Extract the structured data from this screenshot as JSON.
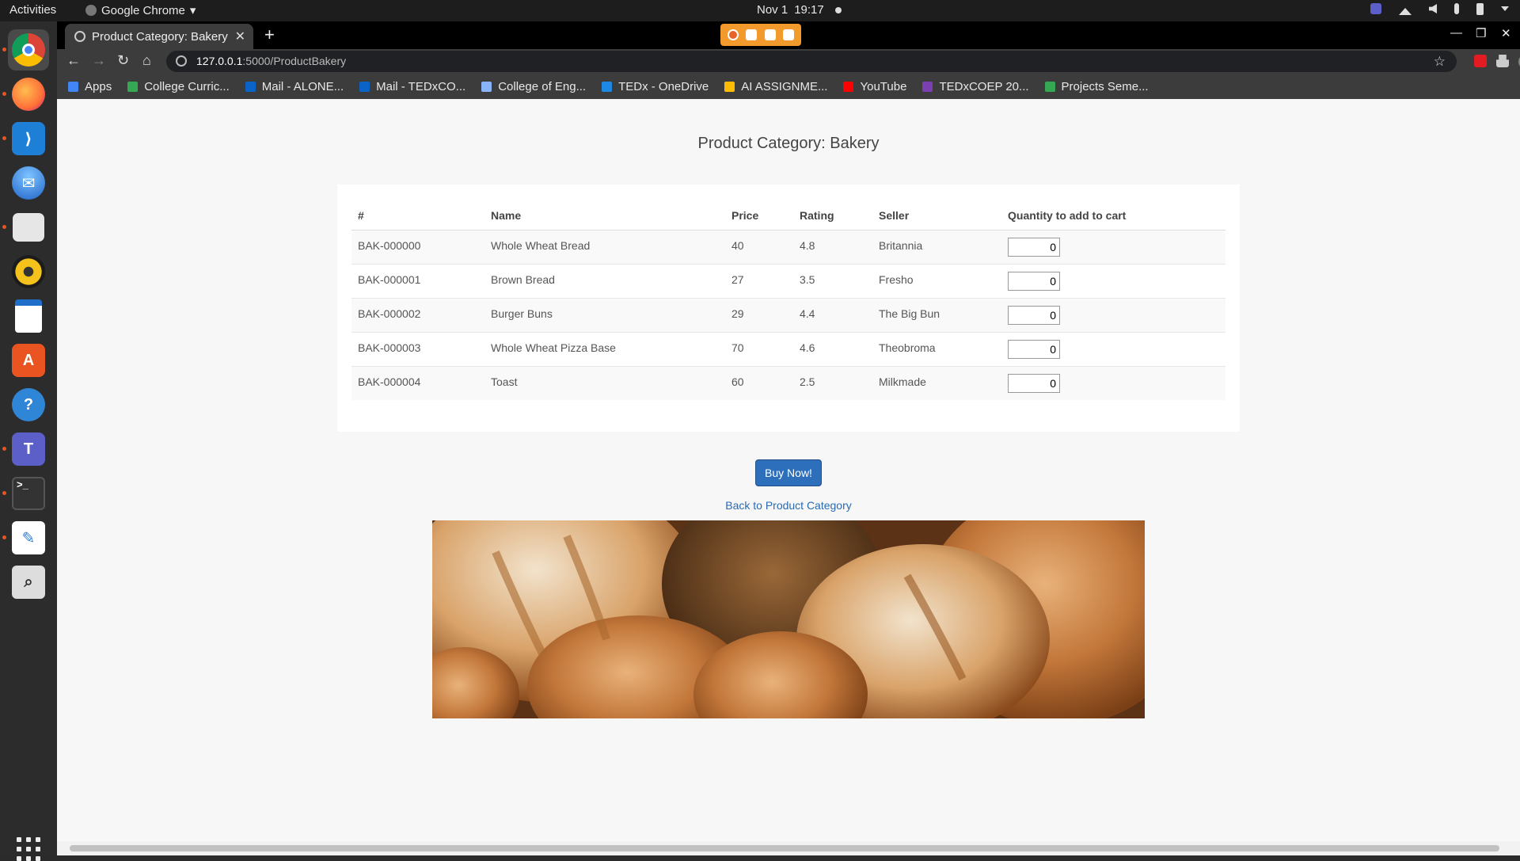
{
  "os": {
    "activities": "Activities",
    "app_name": "Google Chrome",
    "date": "Nov 1",
    "time": "19:17"
  },
  "dock": {
    "apps": [
      "chrome",
      "firefox",
      "vscode",
      "thunderbird",
      "files",
      "rhythmbox",
      "writer",
      "software",
      "help",
      "teams",
      "terminal",
      "text-editor",
      "search"
    ]
  },
  "browser": {
    "tab_title": "Product Category: Bakery",
    "url_host": "127.0.0.1",
    "url_rest": ":5000/ProductBakery",
    "bookmarks": [
      {
        "label": "Apps",
        "color": "#4285f4"
      },
      {
        "label": "College Curric...",
        "color": "#34a853"
      },
      {
        "label": "Mail - ALONE...",
        "color": "#0a64c8"
      },
      {
        "label": "Mail - TEDxCO...",
        "color": "#0a64c8"
      },
      {
        "label": "College of Eng...",
        "color": "#8ab4f8"
      },
      {
        "label": "TEDx - OneDrive",
        "color": "#1e88e5"
      },
      {
        "label": "AI ASSIGNME...",
        "color": "#fbbc04"
      },
      {
        "label": "YouTube",
        "color": "#ff0000"
      },
      {
        "label": "TEDxCOEP 20...",
        "color": "#7b3fb2"
      },
      {
        "label": "Projects Seme...",
        "color": "#34a853"
      }
    ]
  },
  "page": {
    "title": "Product Category: Bakery",
    "headers": [
      "#",
      "Name",
      "Price",
      "Rating",
      "Seller",
      "Quantity to add to cart"
    ],
    "rows": [
      {
        "id": "BAK-000000",
        "name": "Whole Wheat Bread",
        "price": "40",
        "rating": "4.8",
        "seller": "Britannia",
        "qty": "0"
      },
      {
        "id": "BAK-000001",
        "name": "Brown Bread",
        "price": "27",
        "rating": "3.5",
        "seller": "Fresho",
        "qty": "0"
      },
      {
        "id": "BAK-000002",
        "name": "Burger Buns",
        "price": "29",
        "rating": "4.4",
        "seller": "The Big Bun",
        "qty": "0"
      },
      {
        "id": "BAK-000003",
        "name": "Whole Wheat Pizza Base",
        "price": "70",
        "rating": "4.6",
        "seller": "Theobroma",
        "qty": "0"
      },
      {
        "id": "BAK-000004",
        "name": "Toast",
        "price": "60",
        "rating": "2.5",
        "seller": "Milkmade",
        "qty": "0"
      }
    ],
    "buy_label": "Buy Now!",
    "back_link": "Back to Product Category",
    "accent": "#2d6fbb"
  }
}
